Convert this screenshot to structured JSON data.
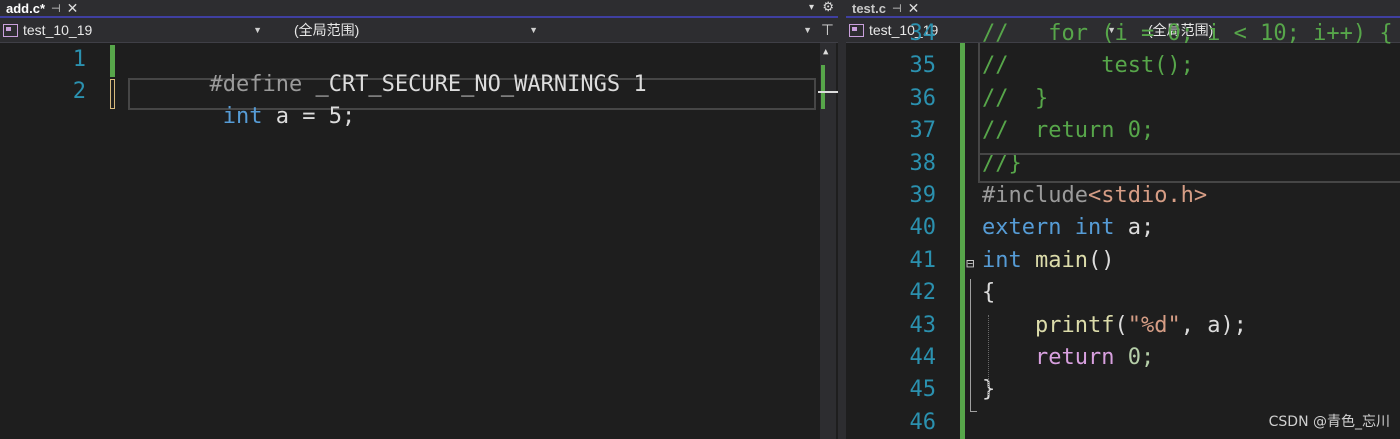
{
  "left": {
    "tab": {
      "title": "add.c*",
      "pin_glyph": "⊣",
      "close_glyph": "✕"
    },
    "nav": {
      "project": "test_10_19",
      "scope": "(全局范围)"
    },
    "lines": [
      {
        "num": "1",
        "parts": [
          {
            "t": "#define ",
            "c": "pp"
          },
          {
            "t": "_CRT_SECURE_NO_WARNINGS 1",
            "c": "txt"
          }
        ]
      },
      {
        "num": "2",
        "parts": [
          {
            "t": " int",
            "c": "kw"
          },
          {
            "t": " a = 5;",
            "c": "txt"
          }
        ]
      }
    ]
  },
  "right": {
    "tab": {
      "title": "test.c",
      "pin_glyph": "⊣",
      "close_glyph": "✕"
    },
    "nav": {
      "project": "test_10_19",
      "scope": "(全局范围)"
    },
    "lines": [
      {
        "num": "34",
        "parts": [
          {
            "t": "//   for (i = 0; i < 10; i++) {",
            "c": "cm"
          }
        ]
      },
      {
        "num": "35",
        "parts": [
          {
            "t": "//       test();",
            "c": "cm"
          }
        ]
      },
      {
        "num": "36",
        "parts": [
          {
            "t": "//  }",
            "c": "cm"
          }
        ]
      },
      {
        "num": "37",
        "parts": [
          {
            "t": "//  return 0;",
            "c": "cm"
          }
        ]
      },
      {
        "num": "38",
        "parts": [
          {
            "t": "//}",
            "c": "cm"
          }
        ]
      },
      {
        "num": "39",
        "parts": [
          {
            "t": "#include",
            "c": "pp"
          },
          {
            "t": "<stdio.h>",
            "c": "inc"
          }
        ]
      },
      {
        "num": "40",
        "parts": [
          {
            "t": "extern ",
            "c": "kw"
          },
          {
            "t": "int",
            "c": "kw"
          },
          {
            "t": " a;",
            "c": "txt"
          }
        ]
      },
      {
        "num": "41",
        "parts": [
          {
            "t": "int ",
            "c": "kw"
          },
          {
            "t": "main",
            "c": "fn"
          },
          {
            "t": "()",
            "c": "txt"
          }
        ]
      },
      {
        "num": "42",
        "parts": [
          {
            "t": "{",
            "c": "txt"
          }
        ]
      },
      {
        "num": "43",
        "parts": [
          {
            "t": "    ",
            "c": "txt"
          },
          {
            "t": "printf",
            "c": "fn"
          },
          {
            "t": "(",
            "c": "txt"
          },
          {
            "t": "\"%d\"",
            "c": "st"
          },
          {
            "t": ", a);",
            "c": "txt"
          }
        ]
      },
      {
        "num": "44",
        "parts": [
          {
            "t": "    ",
            "c": "txt"
          },
          {
            "t": "return",
            "c": "ctl"
          },
          {
            "t": " 0;",
            "c": "num"
          }
        ]
      },
      {
        "num": "45",
        "parts": [
          {
            "t": "}",
            "c": "txt"
          }
        ]
      },
      {
        "num": "46",
        "parts": []
      }
    ]
  },
  "collapse_glyph": "⊟",
  "watermark": "CSDN @青色_忘川",
  "colors": {
    "accent": "#3f3fa0",
    "change_bar": "#57a64a",
    "line_number": "#2b91af"
  }
}
